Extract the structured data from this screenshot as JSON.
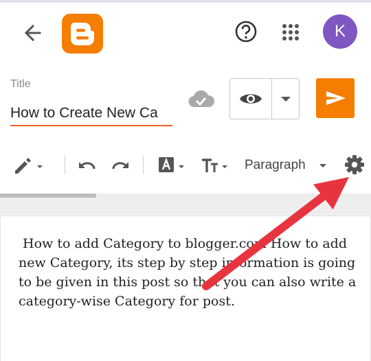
{
  "header": {
    "back_icon": "arrow-left-icon",
    "logo_icon": "blogger-logo",
    "help_icon": "help-circle-icon",
    "apps_icon": "apps-grid-icon",
    "avatar_initial": "K",
    "avatar_color": "#7e57c2"
  },
  "post": {
    "title_label": "Title",
    "title_value": "How to Create New Ca",
    "cloud_icon": "cloud-saved-icon",
    "preview_icon": "eye-icon",
    "preview_dropdown_icon": "caret-down-icon",
    "publish_icon": "send-icon",
    "accent": "#f57d00"
  },
  "toolbar": {
    "pencil_icon": "pencil-icon",
    "undo_icon": "undo-icon",
    "redo_icon": "redo-icon",
    "text_color_icon": "text-color-icon",
    "font_size_icon": "font-size-icon",
    "paragraph_label": "Paragraph",
    "settings_icon": "gear-icon"
  },
  "progress": {
    "value": 0.26
  },
  "editor": {
    "body_text": " How to add Category to blogger.com How to add new Category, its step by step information is going to be given in this post so that you can also write a category-wise Category for post."
  },
  "annotation": {
    "arrow_color": "#e8343f"
  }
}
